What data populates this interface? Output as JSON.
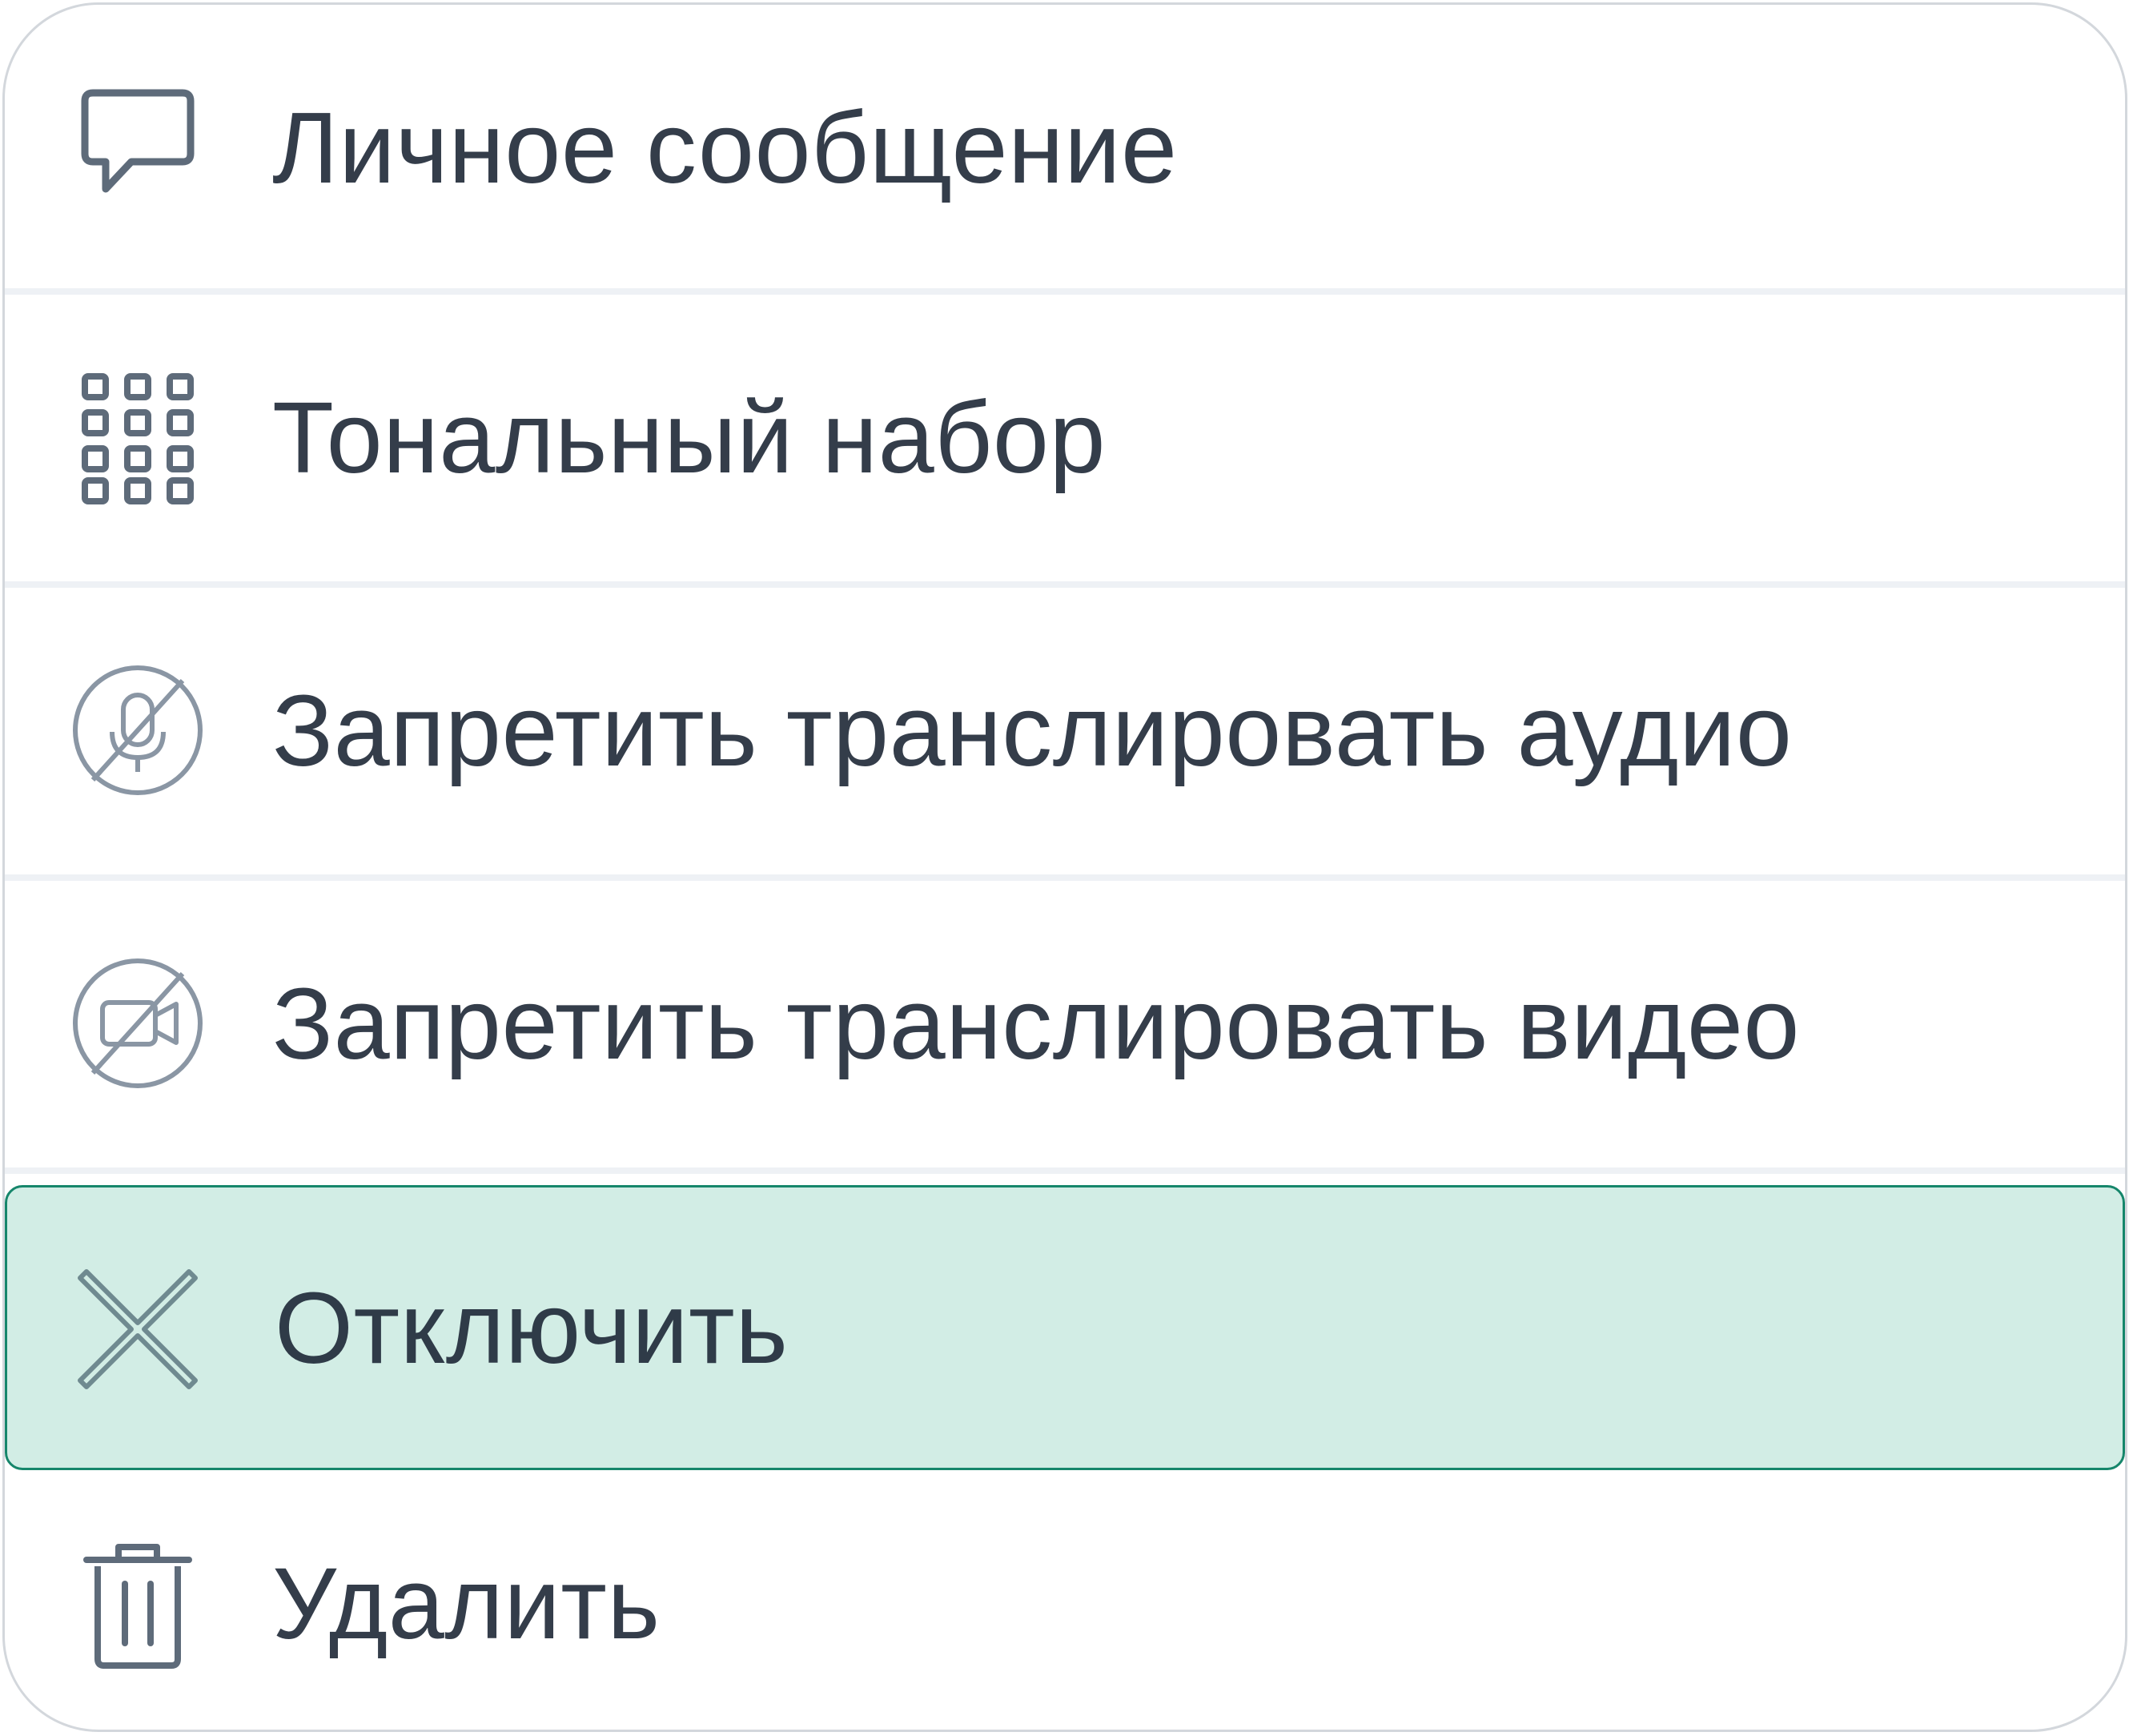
{
  "menu": {
    "items": [
      {
        "label": "Личное сообщение",
        "icon": "chat-bubble-icon",
        "active": false
      },
      {
        "label": "Тональный набор",
        "icon": "dialpad-icon",
        "active": false
      },
      {
        "label": "Запретить транслировать аудио",
        "icon": "mic-off-icon",
        "active": false
      },
      {
        "label": "Запретить транслировать видео",
        "icon": "video-off-icon",
        "active": false
      },
      {
        "label": "Отключить",
        "icon": "close-icon",
        "active": true
      },
      {
        "label": "Удалить",
        "icon": "trash-icon",
        "active": false
      }
    ]
  },
  "colors": {
    "text": "#343d4a",
    "icon": "#5e6b7a",
    "divider": "#eef1f5",
    "active_background": "#d2ede5",
    "active_border": "#16866b",
    "menu_border": "#d3d7dc"
  }
}
